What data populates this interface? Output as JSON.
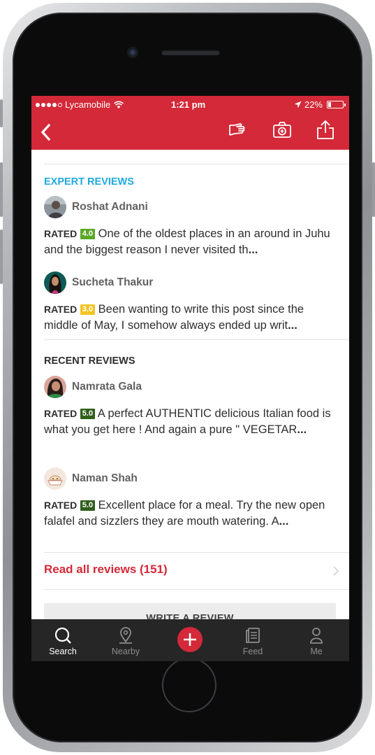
{
  "status_bar": {
    "carrier": "Lycamobile",
    "time": "1:21 pm",
    "battery_percent": "22%",
    "battery_level": 0.22
  },
  "header": {
    "icons": [
      "back-chevron-icon",
      "hand-icon",
      "camera-icon",
      "share-icon"
    ],
    "background_color": "#d32938"
  },
  "expert_reviews": {
    "title": "EXPERT REVIEWS",
    "items": [
      {
        "name": "Roshat Adnani",
        "rated_label": "RATED",
        "rating": "4.0",
        "rating_color": "#5ba829",
        "text": "One of the oldest places in an around in Juhu and the biggest reason I never visited th",
        "ellipsis": "..."
      },
      {
        "name": "Sucheta Thakur",
        "rated_label": "RATED",
        "rating": "3.0",
        "rating_color": "#f2c425",
        "text": "Been wanting to write this post since the middle of May, I somehow always ended up writ",
        "ellipsis": "..."
      }
    ]
  },
  "recent_reviews": {
    "title": "RECENT REVIEWS",
    "items": [
      {
        "name": "Namrata Gala",
        "rated_label": "RATED",
        "rating": "5.0",
        "rating_color": "#2f5f1c",
        "text": "A perfect AUTHENTIC delicious Italian food is what you get here ! And again a pure \" VEGETAR",
        "ellipsis": "..."
      },
      {
        "name": "Naman Shah",
        "rated_label": "RATED",
        "rating": "5.0",
        "rating_color": "#2f5f1c",
        "text": "Excellent place for a meal. Try the new open falafel and sizzlers they are mouth watering. A",
        "ellipsis": "..."
      }
    ]
  },
  "read_all": {
    "label": "Read all reviews (151)"
  },
  "write_review": {
    "label": "WRITE A REVIEW"
  },
  "tab_bar": {
    "tabs": [
      {
        "label": "Search",
        "icon": "search-icon",
        "active": true
      },
      {
        "label": "Nearby",
        "icon": "location-pin-icon",
        "active": false
      },
      {
        "label": "",
        "icon": "add-icon",
        "active": false
      },
      {
        "label": "Feed",
        "icon": "feed-icon",
        "active": false
      },
      {
        "label": "Me",
        "icon": "person-icon",
        "active": false
      }
    ]
  }
}
